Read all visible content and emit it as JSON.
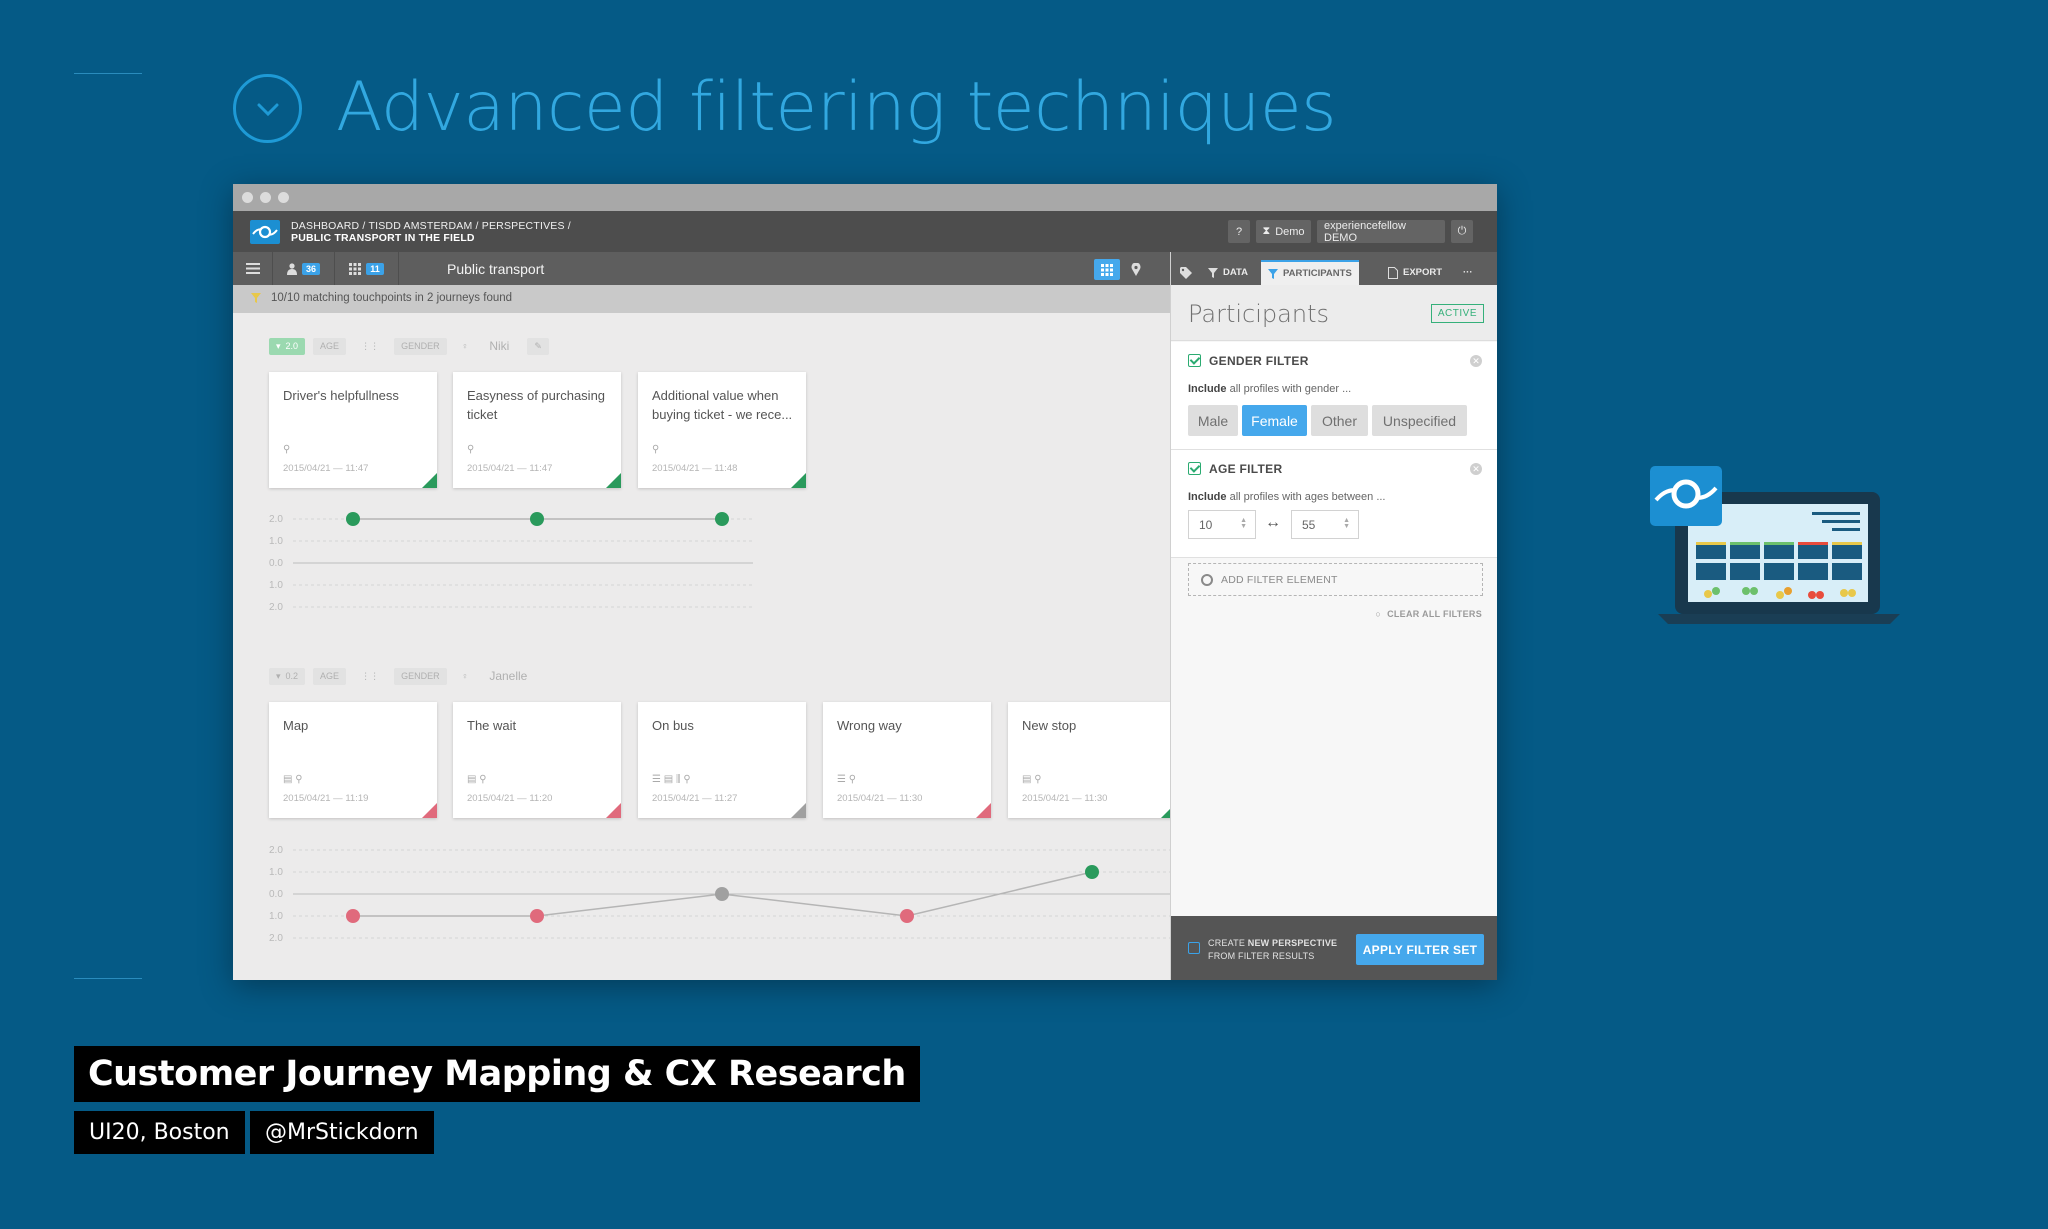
{
  "slide": {
    "title": "Advanced filtering techniques"
  },
  "app": {
    "breadcrumb_line1": "DASHBOARD / TISDD AMSTERDAM / PERSPECTIVES /",
    "breadcrumb_line2": "PUBLIC TRANSPORT IN THE FIELD",
    "help_label": "?",
    "demo_label": "Demo",
    "account_label": "experiencefellow DEMO",
    "participants_count": "36",
    "journeys_count": "11",
    "journey_name": "Public transport",
    "match_text": "10/10 matching touchpoints in 2 journeys found"
  },
  "journeys": [
    {
      "score": "2.0",
      "age_label": "AGE",
      "gender_label": "GENDER",
      "participant": "Niki",
      "cards": [
        {
          "title": "Driver's helpfullness",
          "date": "2015/04/21 — 11:47",
          "rating": "positive"
        },
        {
          "title": "Easyness of purchasing ticket",
          "date": "2015/04/21 — 11:47",
          "rating": "positive"
        },
        {
          "title": "Additional value when buying ticket - we rece...",
          "date": "2015/04/21 — 11:48",
          "rating": "positive"
        }
      ],
      "y_ticks": [
        "2.0",
        "1.0",
        "0.0",
        "1.0",
        "2.0"
      ],
      "values": [
        2,
        2,
        2
      ]
    },
    {
      "score": "0.2",
      "age_label": "AGE",
      "gender_label": "GENDER",
      "participant": "Janelle",
      "cards": [
        {
          "title": "Map",
          "date": "2015/04/21 — 11:19",
          "rating": "negative"
        },
        {
          "title": "The wait",
          "date": "2015/04/21 — 11:20",
          "rating": "negative"
        },
        {
          "title": "On bus",
          "date": "2015/04/21 — 11:27",
          "rating": "neutral"
        },
        {
          "title": "Wrong way",
          "date": "2015/04/21 — 11:30",
          "rating": "negative"
        },
        {
          "title": "New stop",
          "date": "2015/04/21 — 11:30",
          "rating": "positive"
        }
      ],
      "y_ticks": [
        "2.0",
        "1.0",
        "0.0",
        "1.0",
        "2.0"
      ],
      "values": [
        -1,
        -1,
        0,
        -1,
        1
      ]
    }
  ],
  "panel": {
    "tabs": {
      "data": "DATA",
      "participants": "PARTICIPANTS",
      "export": "EXPORT",
      "more": "···"
    },
    "title": "Participants",
    "status": "ACTIVE",
    "gender_filter": {
      "title": "GENDER FILTER",
      "desc_bold": "Include",
      "desc_rest": " all profiles with gender ...",
      "options": [
        "Male",
        "Female",
        "Other",
        "Unspecified"
      ],
      "selected": "Female"
    },
    "age_filter": {
      "title": "AGE FILTER",
      "desc_bold": "Include",
      "desc_rest": " all profiles with ages between ...",
      "min": "10",
      "max": "55",
      "range_symbol": "↔"
    },
    "add_filter": "ADD FILTER ELEMENT",
    "clear_all": "CLEAR ALL FILTERS",
    "footer_line1_pre": "CREATE ",
    "footer_line1_bold": "NEW PERSPECTIVE",
    "footer_line2": "FROM FILTER RESULTS",
    "apply": "APPLY FILTER SET"
  },
  "footer": {
    "talk_title": "Customer Journey Mapping & CX Research",
    "event": "UI20, Boston",
    "handle": "@MrStickdorn"
  },
  "colors": {
    "background": "#055a86",
    "accent": "#45a8ec",
    "positive": "#2a9a5c",
    "negative": "#e06a7c",
    "neutral": "#a0a0a0"
  }
}
